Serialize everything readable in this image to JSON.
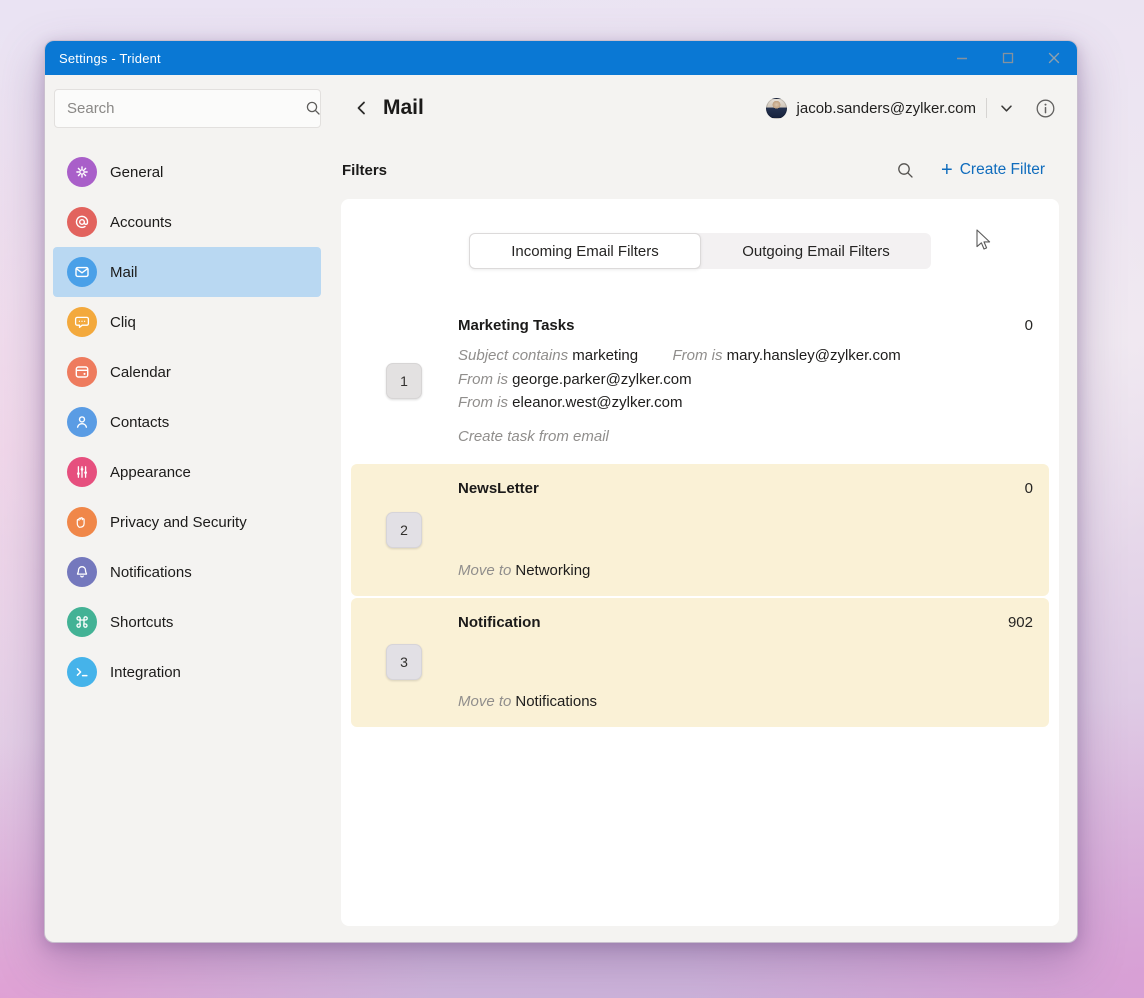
{
  "titlebar": {
    "title": "Settings - Trident"
  },
  "colors": {
    "titlebar_bg": "#0a78d4",
    "accent_blue": "#0f6cbd",
    "selected_item_bg": "#b9d8f2",
    "filter_highlight": "#faf1d6"
  },
  "sidebar": {
    "search_placeholder": "Search",
    "items": [
      {
        "label": "General",
        "icon": "gear-icon",
        "color": "#a95fc9"
      },
      {
        "label": "Accounts",
        "icon": "at-icon",
        "color": "#e2635e"
      },
      {
        "label": "Mail",
        "icon": "envelope-icon",
        "color": "#4aa0e8",
        "selected": true
      },
      {
        "label": "Cliq",
        "icon": "chat-bubble-icon",
        "color": "#f3a93d"
      },
      {
        "label": "Calendar",
        "icon": "calendar-icon",
        "color": "#ee7b5e"
      },
      {
        "label": "Contacts",
        "icon": "person-icon",
        "color": "#5a9ce4"
      },
      {
        "label": "Appearance",
        "icon": "sliders-icon",
        "color": "#e64f7e"
      },
      {
        "label": "Privacy and Security",
        "icon": "hand-icon",
        "color": "#f08749"
      },
      {
        "label": "Notifications",
        "icon": "bell-icon",
        "color": "#7478bd"
      },
      {
        "label": "Shortcuts",
        "icon": "command-icon",
        "color": "#43b295"
      },
      {
        "label": "Integration",
        "icon": "terminal-icon",
        "color": "#45b3ea"
      }
    ]
  },
  "header": {
    "title": "Mail",
    "account_email": "jacob.sanders@zylker.com"
  },
  "filters_bar": {
    "title": "Filters",
    "create_plus": "+",
    "create_label": "Create Filter"
  },
  "tabs": {
    "incoming": "Incoming Email Filters",
    "outgoing": "Outgoing Email Filters",
    "active": "incoming"
  },
  "filters": [
    {
      "index": "1",
      "name": "Marketing Tasks",
      "count": "0",
      "conditions": [
        {
          "label": "Subject contains",
          "value": "marketing"
        },
        {
          "label": "From is",
          "value": "mary.hansley@zylker.com"
        },
        {
          "label": "From is",
          "value": "george.parker@zylker.com"
        },
        {
          "label": "From is",
          "value": "eleanor.west@zylker.com"
        }
      ],
      "action_label": "Create task from email",
      "action_value": "",
      "highlighted": false
    },
    {
      "index": "2",
      "name": "NewsLetter",
      "count": "0",
      "conditions": [],
      "action_label": "Move to",
      "action_value": "Networking",
      "highlighted": true
    },
    {
      "index": "3",
      "name": "Notification",
      "count": "902",
      "conditions": [],
      "action_label": "Move to",
      "action_value": "Notifications",
      "highlighted": true
    }
  ]
}
